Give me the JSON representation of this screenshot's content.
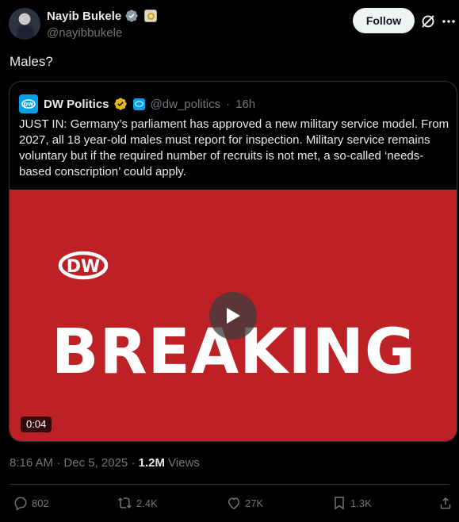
{
  "author": {
    "name": "Nayib Bukele",
    "handle": "@nayibbukele",
    "follow_label": "Follow"
  },
  "tweet": {
    "text": "Males?"
  },
  "quoted": {
    "name": "DW Politics",
    "handle": "@dw_politics",
    "separator": "·",
    "time": "16h",
    "body": "JUST IN: Germany’s parliament has approved a new military service model. From 2027, all 18 year-old males must report for inspection. Military service remains voluntary but if the required number of recruits is not met, a so-called ‘needs-based conscription’ could apply.",
    "video": {
      "logo_text": "DW",
      "headline": "BREAKING",
      "duration": "0:04"
    }
  },
  "meta": {
    "time": "8:16 AM",
    "sep1": "·",
    "date": "Dec 5, 2025",
    "sep2": "·",
    "views_count": "1.2M",
    "views_label": "Views"
  },
  "actions": {
    "replies": "802",
    "reposts": "2.4K",
    "likes": "27K",
    "bookmarks": "1.3K"
  },
  "colors": {
    "background": "#000000",
    "video_red": "#bd2025",
    "dw_blue": "#05a0e5",
    "verified_blue": "#1d9bf0",
    "verified_gold": "#e2b719",
    "muted_text": "#71767b"
  },
  "icons": [
    "verified-badge-icon",
    "affiliate-badge-icon",
    "grok-icon",
    "more-icon",
    "play-icon",
    "reply-icon",
    "repost-icon",
    "like-icon",
    "bookmark-icon",
    "share-icon"
  ]
}
